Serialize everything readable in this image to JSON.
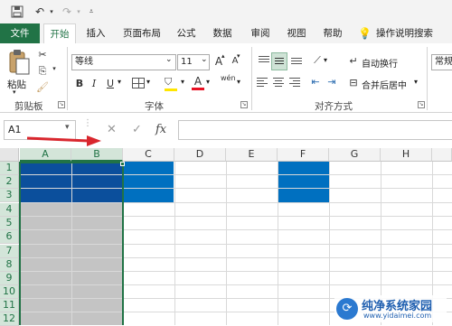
{
  "tabs": [
    "文件",
    "开始",
    "插入",
    "页面布局",
    "公式",
    "数据",
    "审阅",
    "视图",
    "帮助",
    "操作说明搜索"
  ],
  "ribbon": {
    "clipboard": {
      "paste": "粘贴",
      "group": "剪贴板"
    },
    "font": {
      "name": "等线",
      "size": "11",
      "group": "字体",
      "bold": "B",
      "italic": "I",
      "underline": "U",
      "grow": "A",
      "shrink": "A",
      "color_letter": "A",
      "phonetic": "wén"
    },
    "alignment": {
      "wrap": "自动换行",
      "merge": "合并后居中",
      "group": "对齐方式"
    },
    "number": {
      "format": "常规"
    }
  },
  "formula_bar": {
    "name_box": "A1",
    "cancel": "✕",
    "enter": "✓",
    "fx": "fx"
  },
  "columns": [
    "A",
    "B",
    "C",
    "D",
    "E",
    "F",
    "G",
    "H"
  ],
  "rows": [
    "1",
    "2",
    "3",
    "4",
    "5",
    "6",
    "7",
    "8",
    "9",
    "10",
    "11",
    "12"
  ],
  "colors": {
    "excel_green": "#217346",
    "fill_blue": "#0070c0",
    "fill_dark_blue": "#0b4f9c",
    "selection_gray": "#c4c4c4",
    "arrow_red": "#d9272e"
  },
  "watermark": {
    "site": "纯净系统家园",
    "url": "www.yidaimei.com"
  }
}
